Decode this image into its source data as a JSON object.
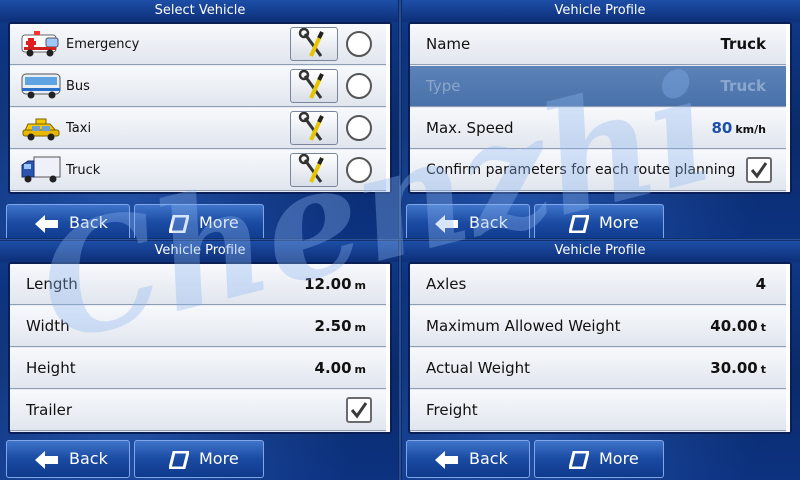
{
  "panels": {
    "select_vehicle": {
      "title": "Select Vehicle",
      "items": [
        {
          "label": "Emergency",
          "icon": "ambulance-icon"
        },
        {
          "label": "Bus",
          "icon": "bus-icon"
        },
        {
          "label": "Taxi",
          "icon": "taxi-icon"
        },
        {
          "label": "Truck",
          "icon": "truck-icon"
        }
      ]
    },
    "profile_1": {
      "title": "Vehicle Profile",
      "name_label": "Name",
      "name_value": "Truck",
      "type_label": "Type",
      "type_value": "Truck",
      "speed_label": "Max. Speed",
      "speed_value": "80",
      "speed_unit": "km/h",
      "confirm_label": "Confirm parameters for each route planning",
      "confirm_checked": true
    },
    "profile_2": {
      "title": "Vehicle Profile",
      "length_label": "Length",
      "length_value": "12.00",
      "length_unit": "m",
      "width_label": "Width",
      "width_value": "2.50",
      "width_unit": "m",
      "height_label": "Height",
      "height_value": "4.00",
      "height_unit": "m",
      "trailer_label": "Trailer",
      "trailer_checked": true
    },
    "profile_3": {
      "title": "Vehicle Profile",
      "axles_label": "Axles",
      "axles_value": "4",
      "max_weight_label": "Maximum Allowed Weight",
      "max_weight_value": "40.00",
      "max_weight_unit": "t",
      "actual_weight_label": "Actual Weight",
      "actual_weight_value": "30.00",
      "actual_weight_unit": "t",
      "freight_label": "Freight"
    }
  },
  "buttons": {
    "back_label": "Back",
    "more_label": "More"
  },
  "watermark": "Chenzhi",
  "colors": {
    "background": "#0f3a8c",
    "row_light": "#e8ecf2",
    "disabled_row": "#5b83b8",
    "accent_number": "#1d4fa8"
  }
}
